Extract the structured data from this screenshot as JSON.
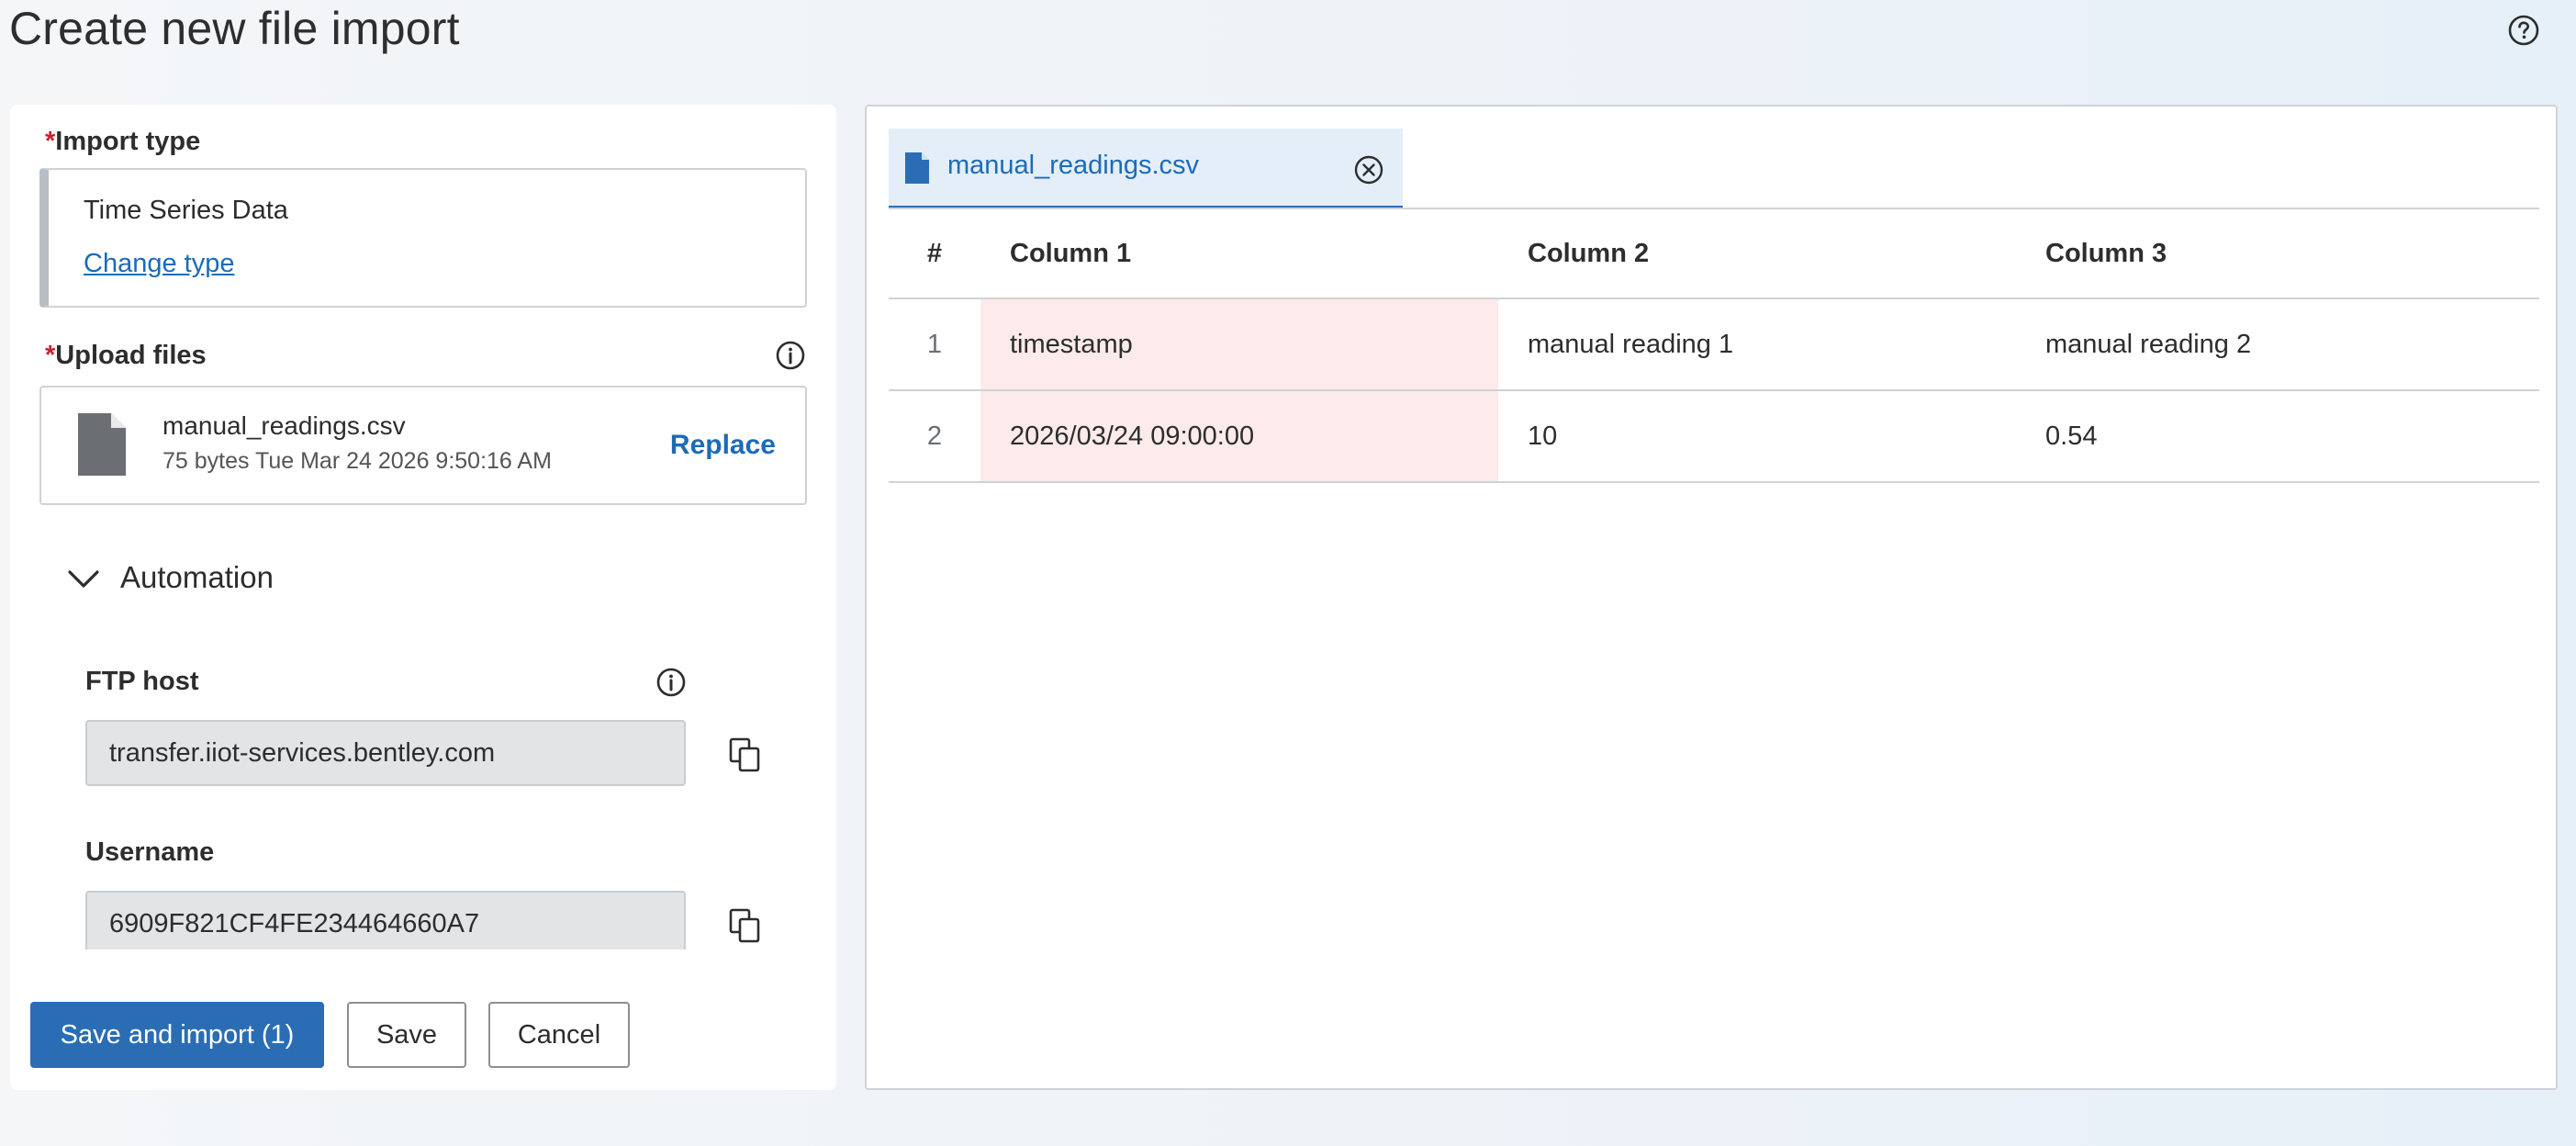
{
  "page": {
    "title": "Create new file import"
  },
  "icons": {
    "help": "help-circle-icon",
    "info": "info-circle-icon",
    "file": "file-icon",
    "copy": "copy-icon",
    "chevron": "chevron-down-icon",
    "close": "close-circle-icon"
  },
  "form": {
    "required_marker": "*",
    "import_type": {
      "label": "Import type",
      "value": "Time Series Data",
      "change_link": "Change type"
    },
    "upload": {
      "label": "Upload files",
      "file_name": "manual_readings.csv",
      "file_meta": "75 bytes Tue Mar 24 2026 9:50:16 AM",
      "replace_label": "Replace"
    },
    "automation": {
      "label": "Automation",
      "expanded": true,
      "ftp_host": {
        "label": "FTP host",
        "value": "transfer.iiot-services.bentley.com"
      },
      "username": {
        "label": "Username",
        "value": "6909F821CF4FE234464660A7"
      }
    },
    "actions": {
      "save_and_import": "Save and import (1)",
      "save": "Save",
      "cancel": "Cancel"
    }
  },
  "preview": {
    "tab_label": "manual_readings.csv",
    "headers": [
      "#",
      "Column 1",
      "Column 2",
      "Column 3"
    ],
    "rows": [
      {
        "num": "1",
        "c1": "timestamp",
        "c2": "manual reading 1",
        "c3": "manual reading 2"
      },
      {
        "num": "2",
        "c1": "2026/03/24 09:00:00",
        "c2": "10",
        "c3": "0.54"
      }
    ],
    "error_column_color": "#fcebea"
  },
  "colors": {
    "accent": "#2a6db5",
    "link": "#1c6bb8",
    "required": "#c7232f",
    "tab_background": "#e3eef8"
  }
}
